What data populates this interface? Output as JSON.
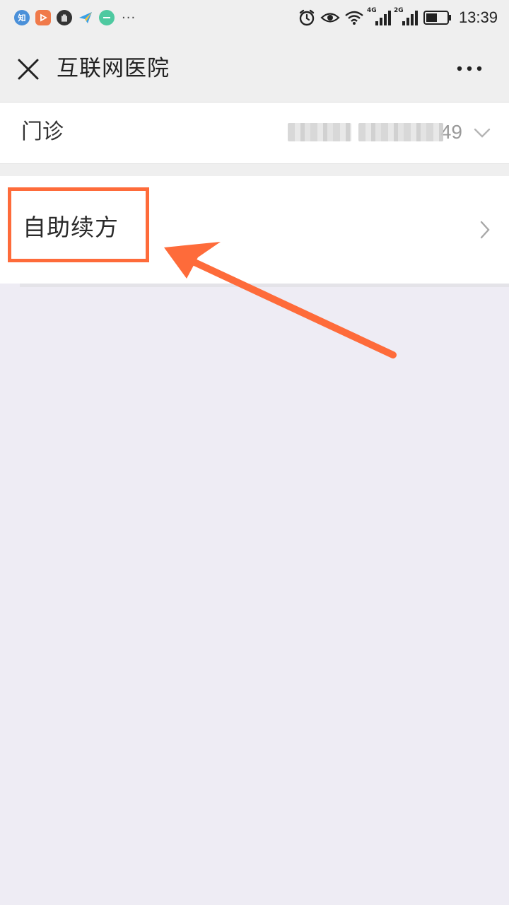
{
  "status_bar": {
    "time": "13:39",
    "app_icons": [
      {
        "name": "zhihu-app-icon",
        "text": "知"
      },
      {
        "name": "video-app-icon",
        "text": ""
      },
      {
        "name": "hand-app-icon",
        "text": ""
      },
      {
        "name": "plane-app-icon",
        "text": ""
      },
      {
        "name": "green-app-icon",
        "text": ""
      }
    ],
    "more_dots": "···",
    "signal_labels": {
      "first": "4G",
      "second": "2G"
    }
  },
  "header": {
    "title": "互联网医院"
  },
  "clinic_row": {
    "label": "门诊",
    "value_suffix": "49"
  },
  "refill_row": {
    "label": "自助续方"
  },
  "colors": {
    "highlight": "#fe6b3a",
    "page_bg": "#eeecf4",
    "header_bg": "#efefef"
  }
}
